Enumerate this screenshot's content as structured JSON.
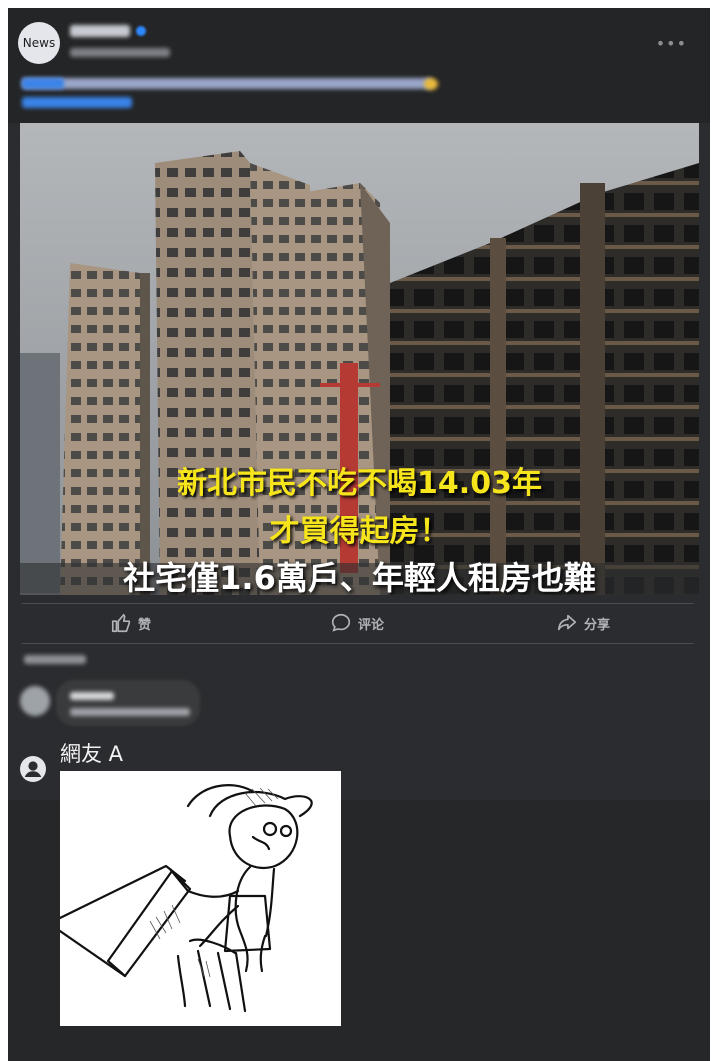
{
  "post": {
    "avatar_label": "News",
    "more_icon": "more-dots-icon"
  },
  "image": {
    "headline_line1": "新北市民不吃不喝14.03年",
    "headline_line2": "才買得起房！",
    "headline_line3": "社宅僅1.6萬戶、年輕人租房也難",
    "colors": {
      "highlight": "#f6e51b",
      "text": "#ffffff"
    }
  },
  "actions": {
    "like": {
      "label": "赞",
      "icon": "thumbs-up-icon"
    },
    "comment": {
      "label": "评论",
      "icon": "comment-bubble-icon"
    },
    "share": {
      "label": "分享",
      "icon": "share-arrow-icon"
    }
  },
  "comment": {
    "user_name": "網友 A",
    "user_icon": "user-circle-icon",
    "image": "table-flip-meme"
  }
}
